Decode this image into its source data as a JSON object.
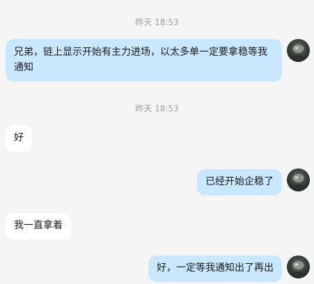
{
  "conversation": {
    "messages": [
      {
        "type": "timestamp",
        "text": "昨天 18:53"
      },
      {
        "type": "sent",
        "text": "兄弟，链上显示开始有主力进场，以太多单一定要拿稳等我通知"
      },
      {
        "type": "timestamp",
        "text": "昨天 18:53"
      },
      {
        "type": "received",
        "text": "好"
      },
      {
        "type": "sent",
        "text": "已经开始企稳了"
      },
      {
        "type": "received",
        "text": "我一直拿着"
      },
      {
        "type": "sent",
        "text": "好，一定等我通知出了再出"
      }
    ]
  },
  "avatar_icon": "user-avatar-icon",
  "colors": {
    "background": "#f5f5f5",
    "sent_bubble": "#c9e7fd",
    "received_bubble": "#ffffff",
    "timestamp_text": "#9e9e9e"
  }
}
